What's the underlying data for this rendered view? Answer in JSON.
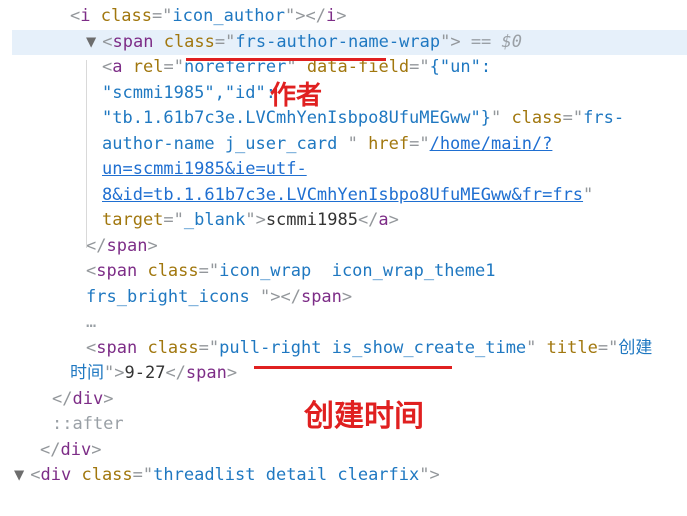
{
  "selected_marker": "$0",
  "ellipsis": "…",
  "pseudo_after": "::after",
  "annotations": {
    "author": "作者",
    "create_time": "创建时间"
  },
  "nodes": {
    "div": {
      "tag": "div"
    },
    "icon_author": {
      "tag": "i",
      "class": "icon_author"
    },
    "author_wrap": {
      "tag": "span",
      "class": "frs-author-name-wrap"
    },
    "author_link": {
      "tag": "a",
      "rel": "noreferrer",
      "data_field_l1": "{\"un\":",
      "data_field_l2": "\"scmmi1985\",\"id\":",
      "data_field_l3": "\"tb.1.61b7c3e.LVCmhYenIsbpo8UfuMEGww\"}",
      "class_l1": "frs-",
      "class_l2": "author-name j_user_card ",
      "href_l1": "/home/main/?",
      "href_l2": "un=scmmi1985&ie=utf-",
      "href_l3": "8&id=tb.1.61b7c3e.LVCmhYenIsbpo8UfuMEGww&fr=frs",
      "target": "_blank",
      "text": "scmmi1985"
    },
    "icon_wrap": {
      "tag": "span",
      "class_l1": "icon_wrap  icon_wrap_theme1",
      "class_l2": "frs_bright_icons "
    },
    "create_time": {
      "tag": "span",
      "class": "pull-right is_show_create_time",
      "title_l1": "创建",
      "title_l2": "时间",
      "text": "9-27"
    },
    "threadlist": {
      "tag": "div",
      "class": "threadlist detail clearfix"
    }
  }
}
